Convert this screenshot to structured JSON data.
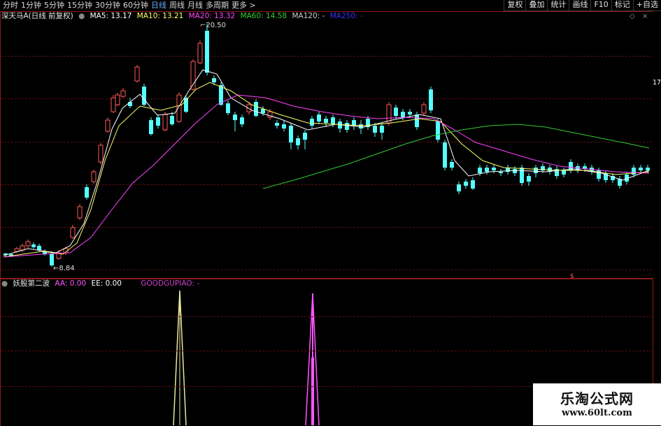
{
  "toolbar": {
    "periods": [
      "分时",
      "1分钟",
      "5分钟",
      "15分钟",
      "30分钟",
      "60分钟",
      "日线",
      "周线",
      "月线",
      "多周期",
      "更多 >"
    ],
    "active_index": 6,
    "buttons": [
      "复权",
      "叠加",
      "统计",
      "画线",
      "F10",
      "标记",
      "+自选"
    ]
  },
  "main": {
    "title": "深天马A(日线 前复权)",
    "ma_values": {
      "ma5": "MA5: 13.17",
      "ma10": "MA10: 13.21",
      "ma20": "MA20: 13.32",
      "ma60": "MA60: 14.58",
      "ma120": "MA120: -",
      "ma250": "MA250: -"
    },
    "colors": {
      "ma5": "#ffffff",
      "ma10": "#ffff66",
      "ma20": "#ff44ff",
      "ma60": "#33cc33",
      "ma120": "#cccccc",
      "ma250": "#3333ff",
      "up": "#ff5a5a",
      "down": "#55ffff"
    },
    "high_label": "20.50",
    "low_label": "8.84",
    "axis_label": "17"
  },
  "sub": {
    "title": "妖股第二波",
    "aa": "AA: 0.00",
    "ee": "EE: 0.00",
    "extra": "GOODGUPIAO: -",
    "colors": {
      "aa": "#ff55ff",
      "ee": "#ffffff",
      "extra": "#cc44cc",
      "spike1": "#e8e8a0",
      "spike2": "#ff55ff"
    }
  },
  "watermark": {
    "title": "乐淘公式网",
    "url": "www.60lt.com"
  },
  "chart_data": {
    "type": "candlestick",
    "title": "深天马A(日线 前复权)",
    "price_marks": {
      "high": 20.5,
      "low": 8.84
    },
    "axis_label_value": 17,
    "indicator_values": {
      "MA5": 13.17,
      "MA10": 13.21,
      "MA20": 13.32,
      "MA60": 14.58
    },
    "sub_indicator": {
      "name": "妖股第二波",
      "AA": 0.0,
      "EE": 0.0
    }
  }
}
